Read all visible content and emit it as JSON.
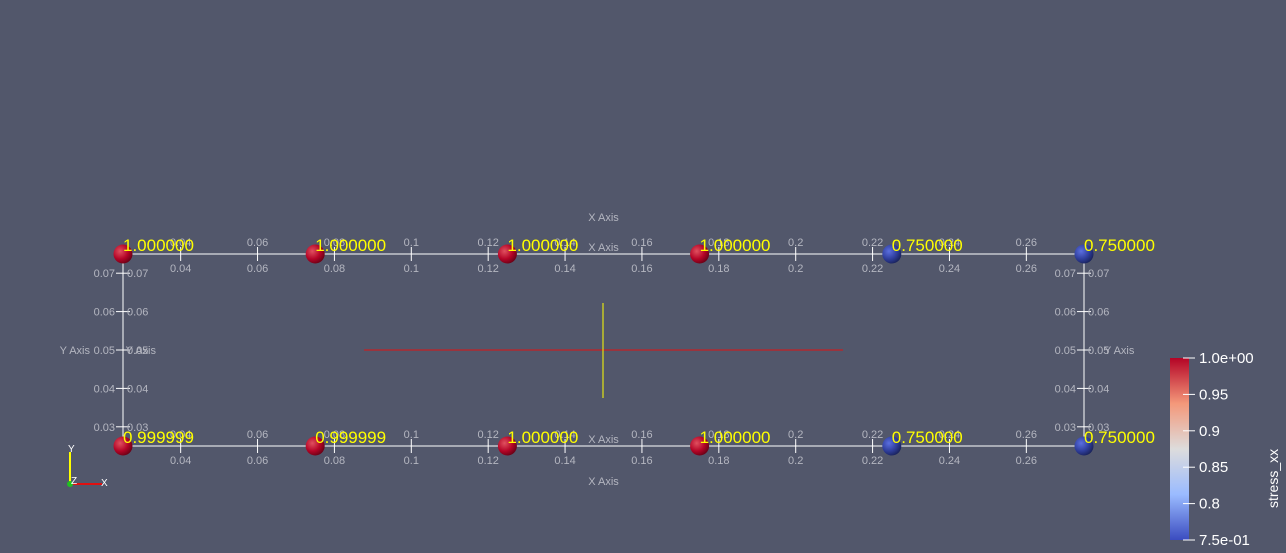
{
  "chart_data": {
    "type": "scatter",
    "title": "",
    "xlabel": "X Axis",
    "ylabel": "Y Axis",
    "xlim": [
      0.025,
      0.275
    ],
    "ylim": [
      0.025,
      0.075
    ],
    "x_ticks": [
      0.04,
      0.06,
      0.08,
      0.1,
      0.12,
      0.14,
      0.16,
      0.18,
      0.2,
      0.22,
      0.24,
      0.26
    ],
    "x_tick_labels": [
      "0.04",
      "0.06",
      "0.08",
      "0.1",
      "0.12",
      "0.14",
      "0.16",
      "0.18",
      "0.2",
      "0.22",
      "0.24",
      "0.26"
    ],
    "y_ticks": [
      0.03,
      0.04,
      0.05,
      0.06,
      0.07
    ],
    "y_tick_labels": [
      "0.03",
      "0.04",
      "0.05",
      "0.06",
      "0.07"
    ],
    "points": [
      {
        "x": 0.025,
        "y": 0.075,
        "value": 1.0,
        "label": "1.000000"
      },
      {
        "x": 0.075,
        "y": 0.075,
        "value": 1.0,
        "label": "1.000000"
      },
      {
        "x": 0.125,
        "y": 0.075,
        "value": 1.0,
        "label": "1.000000"
      },
      {
        "x": 0.175,
        "y": 0.075,
        "value": 1.0,
        "label": "1.000000"
      },
      {
        "x": 0.225,
        "y": 0.075,
        "value": 0.75,
        "label": "0.750000"
      },
      {
        "x": 0.275,
        "y": 0.075,
        "value": 0.75,
        "label": "0.750000"
      },
      {
        "x": 0.025,
        "y": 0.025,
        "value": 0.999999,
        "label": "0.999999"
      },
      {
        "x": 0.075,
        "y": 0.025,
        "value": 0.999999,
        "label": "0.999999"
      },
      {
        "x": 0.125,
        "y": 0.025,
        "value": 1.0,
        "label": "1.000000"
      },
      {
        "x": 0.175,
        "y": 0.025,
        "value": 1.0,
        "label": "1.000000"
      },
      {
        "x": 0.225,
        "y": 0.025,
        "value": 0.75,
        "label": "0.750000"
      },
      {
        "x": 0.275,
        "y": 0.025,
        "value": 0.75,
        "label": "0.750000"
      }
    ],
    "colorbar": {
      "title": "stress_xx",
      "range": [
        0.75,
        1.0
      ],
      "tick_labels": [
        "1.0e+00",
        "0.95",
        "0.9",
        "0.85",
        "0.8",
        "7.5e-01"
      ],
      "tick_values": [
        1.0,
        0.95,
        0.9,
        0.85,
        0.8,
        0.75
      ],
      "colors": [
        "#b40426",
        "#f4987a",
        "#dddcdc",
        "#9abbff",
        "#3b4cc0"
      ]
    },
    "colors": {
      "high_marker": "#b40426",
      "low_marker": "#3b4cc0",
      "value_label": "#ffff00",
      "axis_line": "#ffffff",
      "center_x_line": "#ff0000",
      "center_y_line": "#ffff00",
      "background": "#52576b"
    }
  },
  "orientation_axes": {
    "x": "X",
    "y": "Y",
    "z": "Z"
  }
}
